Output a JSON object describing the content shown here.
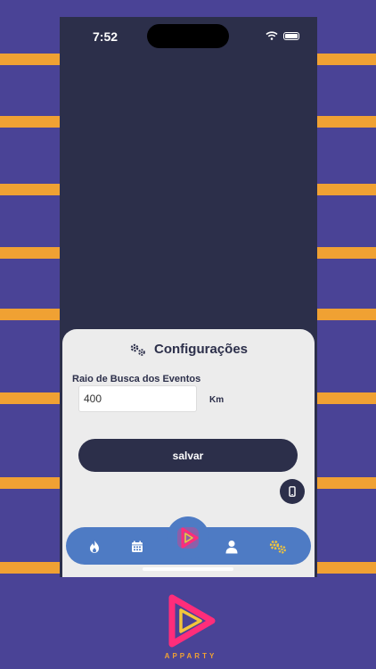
{
  "status_bar": {
    "time": "7:52"
  },
  "settings": {
    "title": "Configurações",
    "field_label": "Raio de Busca dos Eventos",
    "radius_value": "400",
    "unit": "Km",
    "save_label": "salvar"
  },
  "nav": {
    "items": [
      "fire-icon",
      "calendar-icon",
      "play-icon",
      "user-icon",
      "gears-icon"
    ]
  },
  "brand": {
    "name": "APPARTY"
  },
  "colors": {
    "background": "#4a4396",
    "stripe": "#f0a133",
    "app_dark": "#2c2f4a",
    "sheet": "#ececec",
    "nav": "#4e7bc4",
    "accent_pink": "#ff2d7a",
    "accent_yellow": "#f3c53b"
  }
}
